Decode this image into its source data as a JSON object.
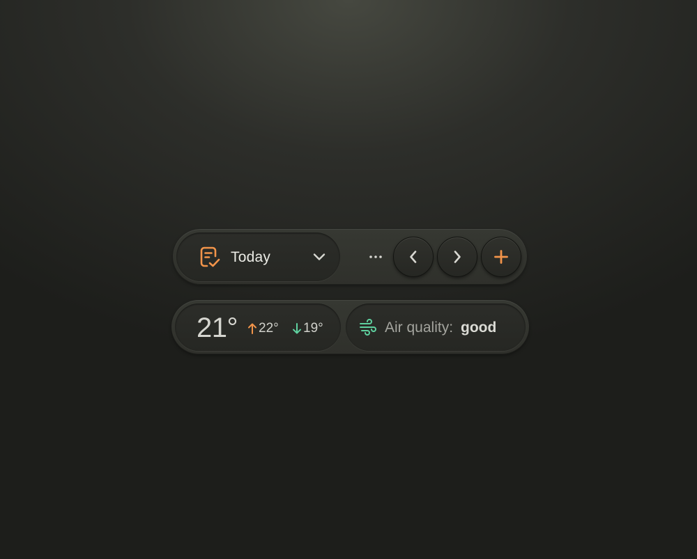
{
  "toolbar": {
    "date_label": "Today",
    "icons": {
      "date": "document-check-icon",
      "dropdown": "chevron-down-icon",
      "more": "more-horizontal-icon",
      "prev": "chevron-left-icon",
      "next": "chevron-right-icon",
      "add": "plus-icon"
    }
  },
  "weather": {
    "current_temp": "21°",
    "high_temp": "22°",
    "low_temp": "19°",
    "icons": {
      "high": "arrow-up-icon",
      "low": "arrow-down-icon",
      "air": "wind-icon"
    }
  },
  "air_quality": {
    "label": "Air quality:",
    "value": "good"
  },
  "colors": {
    "accent_orange": "#f2944a",
    "accent_green": "#5fd2a0",
    "text_primary": "#ecece6",
    "text_muted": "#a4a49e"
  }
}
